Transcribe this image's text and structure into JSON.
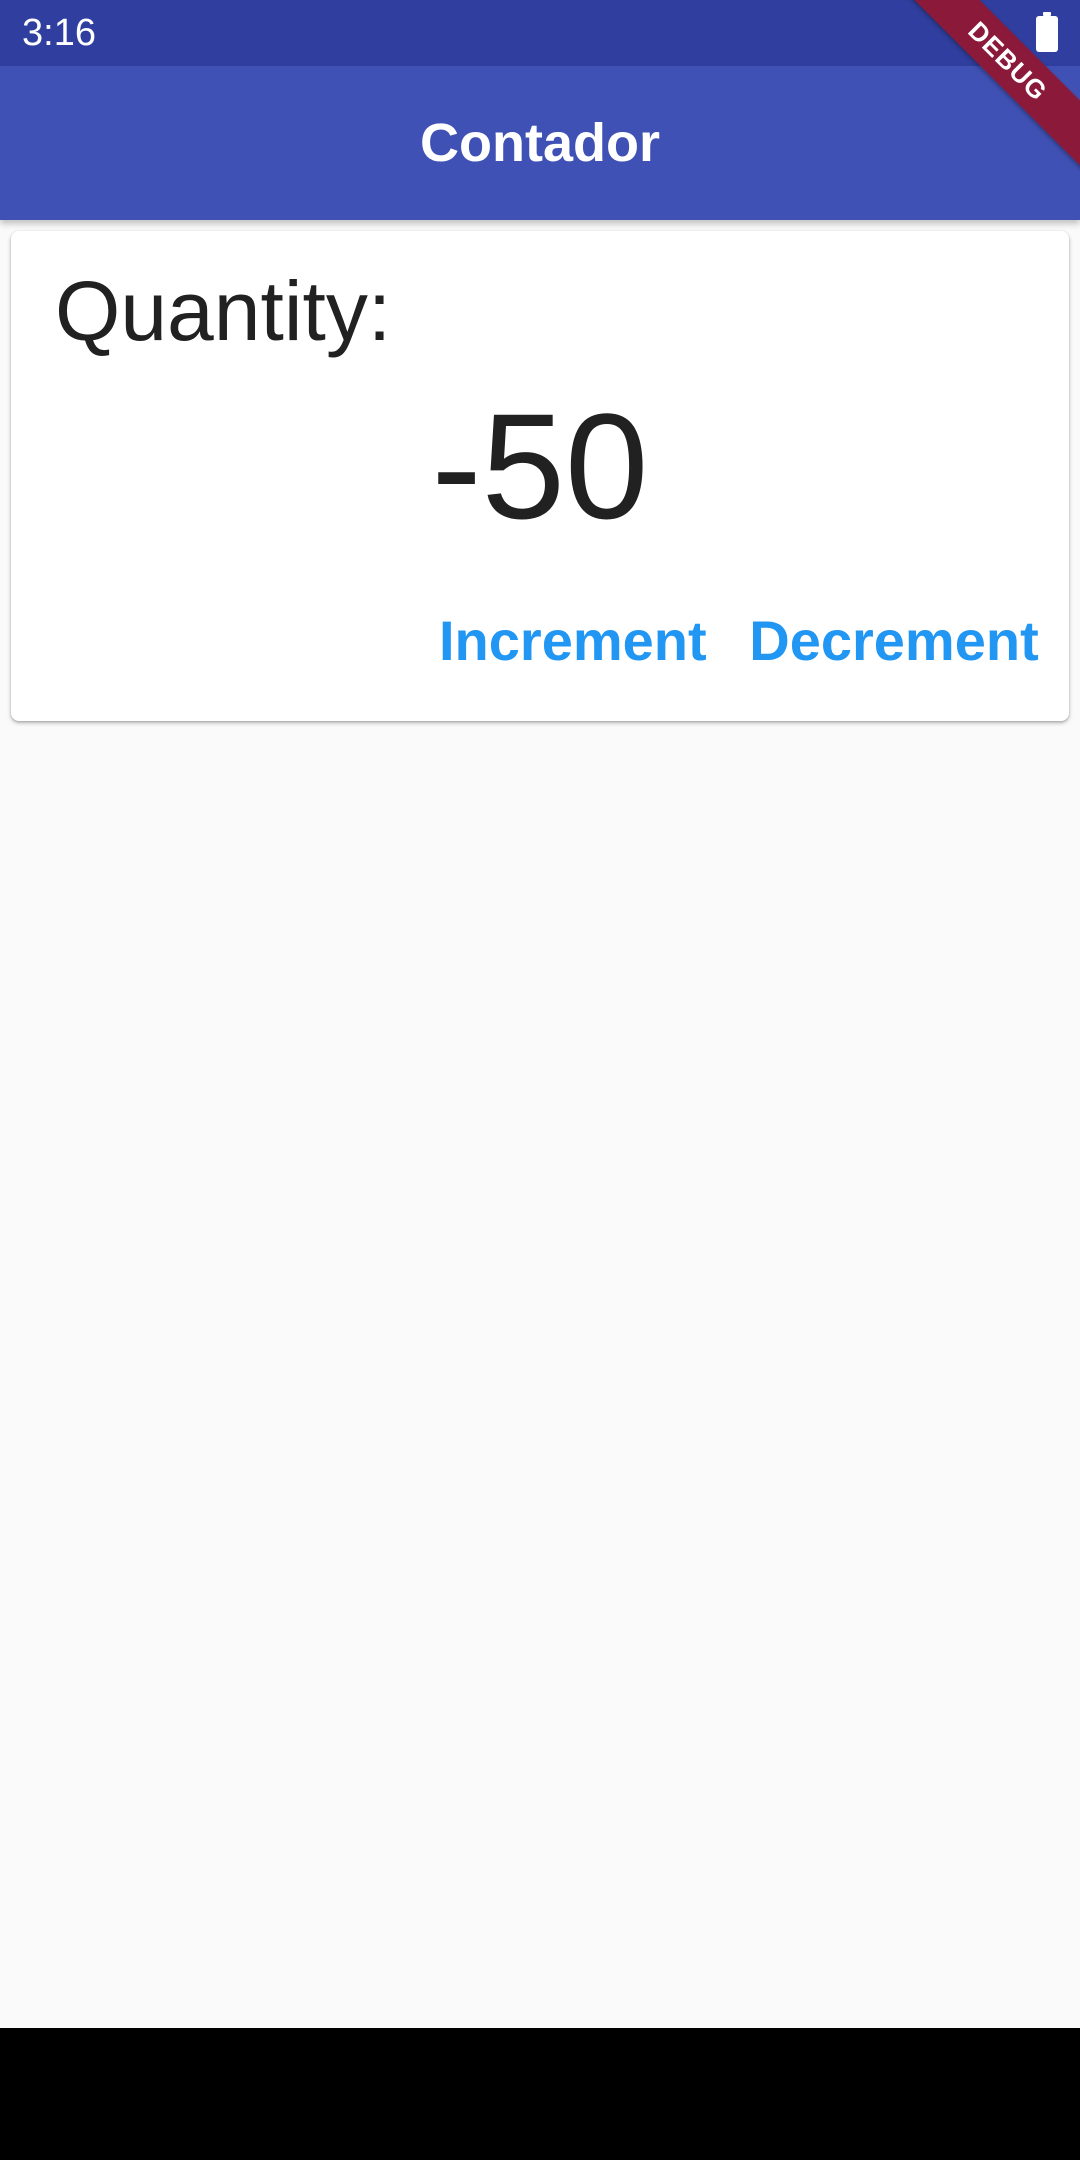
{
  "status_bar": {
    "time": "3:16",
    "battery_icon": "battery-full-icon"
  },
  "app_bar": {
    "title": "Contador",
    "color": "#3f51b5"
  },
  "debug_banner": {
    "label": "DEBUG"
  },
  "card": {
    "label": "Quantity:",
    "value": "-50",
    "buttons": {
      "increment": "Increment",
      "decrement": "Decrement"
    }
  },
  "colors": {
    "accent": "#2196f3",
    "status_bar": "#303f9f",
    "background": "#fafafa"
  }
}
